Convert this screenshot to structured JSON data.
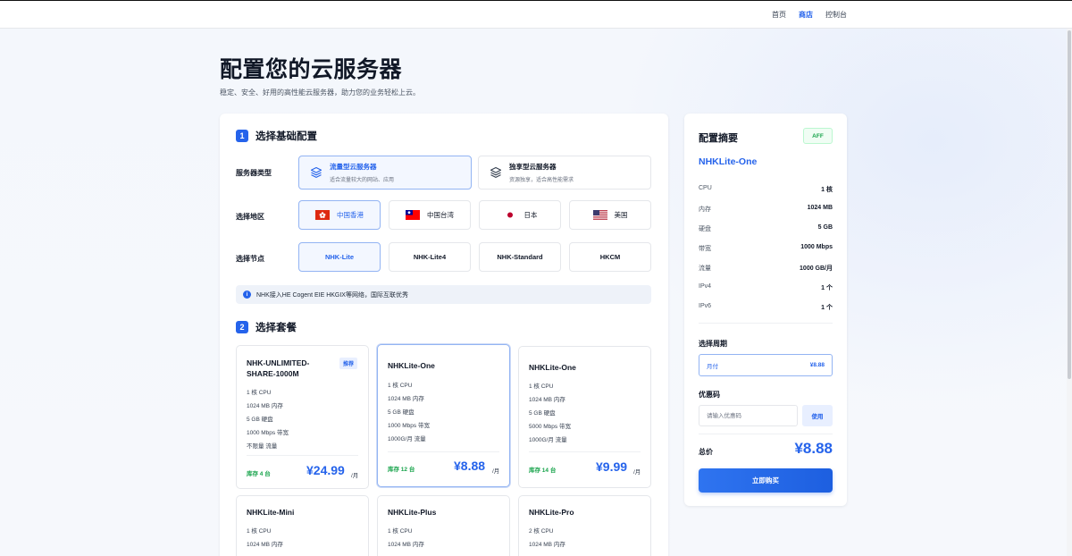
{
  "nav": {
    "items": [
      "首页",
      "商店",
      "控制台"
    ],
    "active_index": 1
  },
  "page": {
    "title": "配置您的云服务器",
    "subtitle": "稳定、安全、好用的高性能云服务器，助力您的业务轻松上云。"
  },
  "section1": {
    "step": "1",
    "title": "选择基础配置",
    "server_type_label": "服务器类型",
    "server_types": [
      {
        "title": "流量型云服务器",
        "desc": "适合流量较大的网站、应用",
        "selected": true
      },
      {
        "title": "独享型云服务器",
        "desc": "资源独享，适合高性能需求",
        "selected": false
      }
    ],
    "region_label": "选择地区",
    "regions": [
      {
        "label": "中国香港",
        "flag": "hk-flag-icon",
        "selected": true
      },
      {
        "label": "中国台湾",
        "flag": "tw-flag-icon",
        "selected": false
      },
      {
        "label": "日本",
        "flag": "jp-flag-icon",
        "selected": false
      },
      {
        "label": "美国",
        "flag": "us-flag-icon",
        "selected": false
      }
    ],
    "node_label": "选择节点",
    "nodes": [
      {
        "label": "NHK-Lite",
        "selected": true
      },
      {
        "label": "NHK-Lite4",
        "selected": false
      },
      {
        "label": "NHK-Standard",
        "selected": false
      },
      {
        "label": "HKCM",
        "selected": false
      }
    ],
    "info": "NHK接入HE Cogent EIE HKGIX等网络，国际互联优秀"
  },
  "section2": {
    "step": "2",
    "title": "选择套餐",
    "plans": [
      {
        "name": "NHK-UNLIMITED-SHARE-1000M",
        "badge": "推荐",
        "specs": [
          "1 核 CPU",
          "1024 MB 内存",
          "5 GB 硬盘",
          "1000 Mbps 带宽",
          "不限量 流量"
        ],
        "stock": "库存 4 台",
        "price": "¥24.99",
        "per": "/月",
        "selected": false
      },
      {
        "name": "NHKLite-One",
        "badge": "",
        "specs": [
          "1 核 CPU",
          "1024 MB 内存",
          "5 GB 硬盘",
          "1000 Mbps 带宽",
          "1000G/月 流量"
        ],
        "stock": "库存 12 台",
        "price": "¥8.88",
        "per": "/月",
        "selected": true
      },
      {
        "name": "NHKLite-One",
        "badge": "",
        "specs": [
          "1 核 CPU",
          "1024 MB 内存",
          "5 GB 硬盘",
          "5000 Mbps 带宽",
          "1000G/月 流量"
        ],
        "stock": "库存 14 台",
        "price": "¥9.99",
        "per": "/月",
        "selected": false
      },
      {
        "name": "NHKLite-Mini",
        "specs": [
          "1 核 CPU",
          "1024 MB 内存"
        ]
      },
      {
        "name": "NHKLite-Plus",
        "specs": [
          "1 核 CPU",
          "1024 MB 内存"
        ]
      },
      {
        "name": "NHKLite-Pro",
        "specs": [
          "2 核 CPU",
          "1024 MB 内存"
        ]
      }
    ]
  },
  "summary": {
    "title": "配置摘要",
    "aff": "AFF",
    "plan_name": "NHKLite-One",
    "specs": [
      {
        "k": "CPU",
        "v": "1 核"
      },
      {
        "k": "内存",
        "v": "1024 MB"
      },
      {
        "k": "硬盘",
        "v": "5 GB"
      },
      {
        "k": "带宽",
        "v": "1000 Mbps"
      },
      {
        "k": "流量",
        "v": "1000 GB/月"
      },
      {
        "k": "IPv4",
        "v": "1 个"
      },
      {
        "k": "IPv6",
        "v": "1 个"
      }
    ],
    "period_label": "选择周期",
    "period_value": "月付",
    "period_price": "¥8.88",
    "coupon_label": "优惠码",
    "coupon_placeholder": "请输入优惠码",
    "coupon_button": "使用",
    "total_label": "总价",
    "total_price": "¥8.88",
    "buy_button": "立即购买"
  },
  "colors": {
    "accent": "#2563eb",
    "success": "#16a34a",
    "text": "#111827"
  }
}
